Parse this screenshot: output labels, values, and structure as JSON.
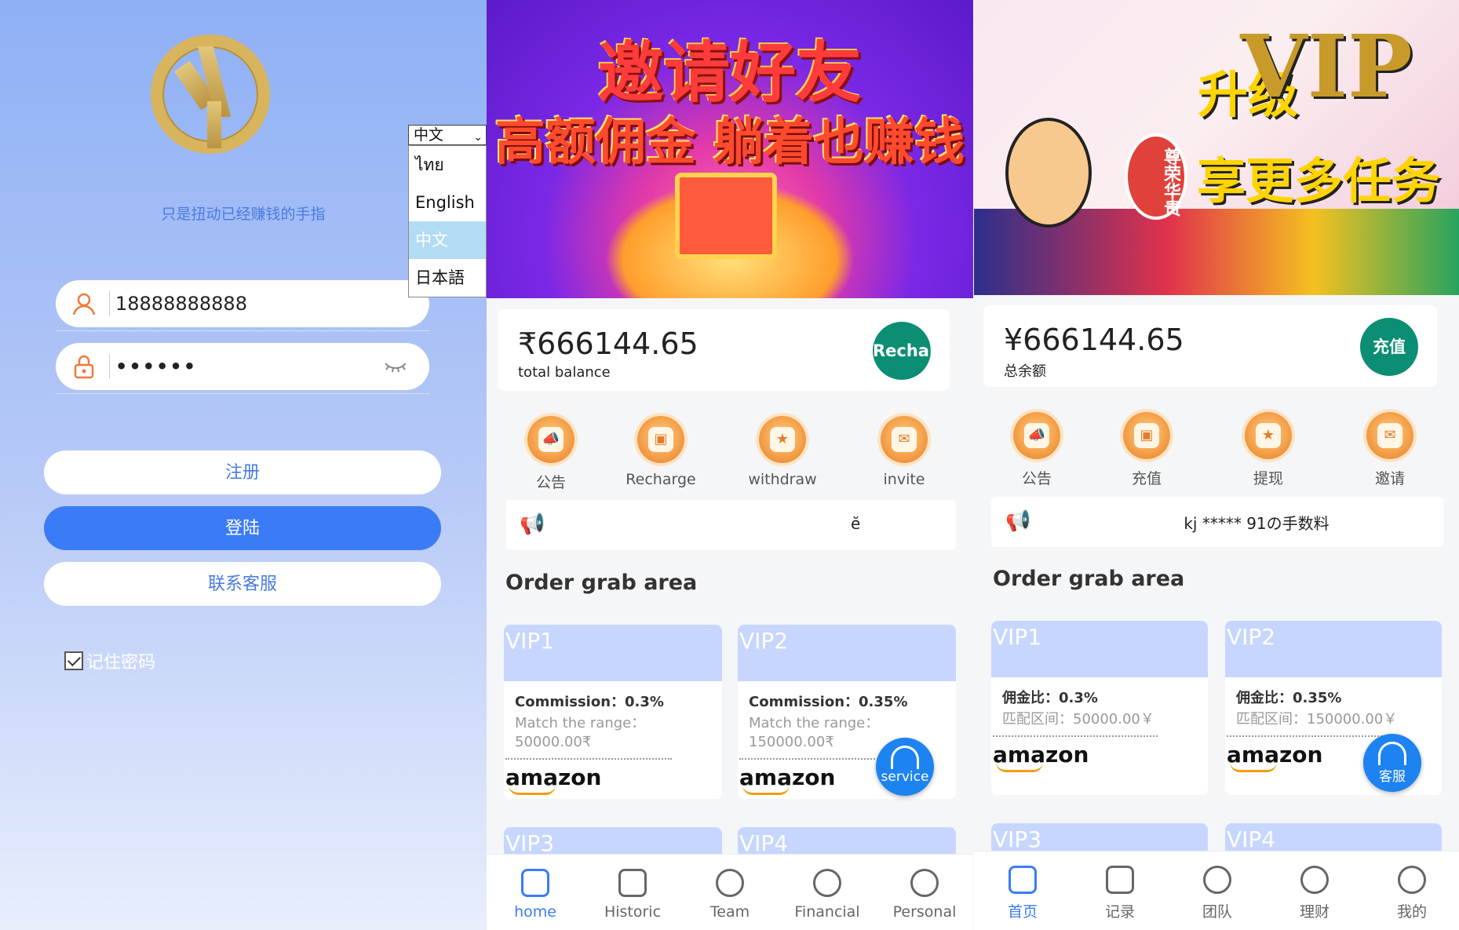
{
  "login": {
    "slogan": "只是扭动已经赚钱的手指",
    "phone_value": "18888888888",
    "password_value": "••••••",
    "register_label": "注册",
    "login_label": "登陆",
    "contact_label": "联系客服",
    "remember_label": "记住密码",
    "language": {
      "selected": "中文",
      "options": [
        "ไทย",
        "English",
        "中文",
        "日本語"
      ]
    }
  },
  "app_en": {
    "banner": {
      "line1": "邀请好友",
      "line2": "高额佣金 躺着也赚钱"
    },
    "balance": "₹666144.65",
    "balance_label": "total balance",
    "recharge_button": "Rechar",
    "menu": [
      "公告",
      "Recharge",
      "withdraw",
      "invite"
    ],
    "notice": "",
    "notice_extra": "ĕ",
    "section_title": "Order grab area",
    "vip_cards": [
      {
        "name": "VIP1",
        "commission": "Commission：0.3%",
        "range": "Match the range：50000.00₹"
      },
      {
        "name": "VIP2",
        "commission": "Commission：0.35%",
        "range": "Match the range：150000.00₹"
      },
      {
        "name": "VIP3"
      },
      {
        "name": "VIP4"
      }
    ],
    "brand": "amazon",
    "service_label": "service",
    "tabs": [
      "home",
      "Historic",
      "Team",
      "Financial",
      "Personal"
    ]
  },
  "app_zh": {
    "banner": {
      "line1": "升级",
      "line2": "VIP",
      "line3": "享更多任务",
      "badge": "尊荣华贵"
    },
    "balance": "¥666144.65",
    "balance_label": "总余额",
    "recharge_button": "充值",
    "menu": [
      "公告",
      "充值",
      "提现",
      "邀请"
    ],
    "notice": "kj ***** 91の手数料",
    "section_title": "Order grab area",
    "vip_cards": [
      {
        "name": "VIP1",
        "commission": "佣金比：0.3%",
        "range": "匹配区间：50000.00￥"
      },
      {
        "name": "VIP2",
        "commission": "佣金比：0.35%",
        "range": "匹配区间：150000.00￥"
      },
      {
        "name": "VIP3"
      },
      {
        "name": "VIP4"
      }
    ],
    "brand": "amazon",
    "service_label": "客服",
    "tabs": [
      "首页",
      "记录",
      "团队",
      "理财",
      "我的"
    ]
  },
  "colors": {
    "primary": "#3b7cf6",
    "recharge": "#0b8e73",
    "vip_header": "#c7d6ff",
    "service": "#1c83f0"
  }
}
